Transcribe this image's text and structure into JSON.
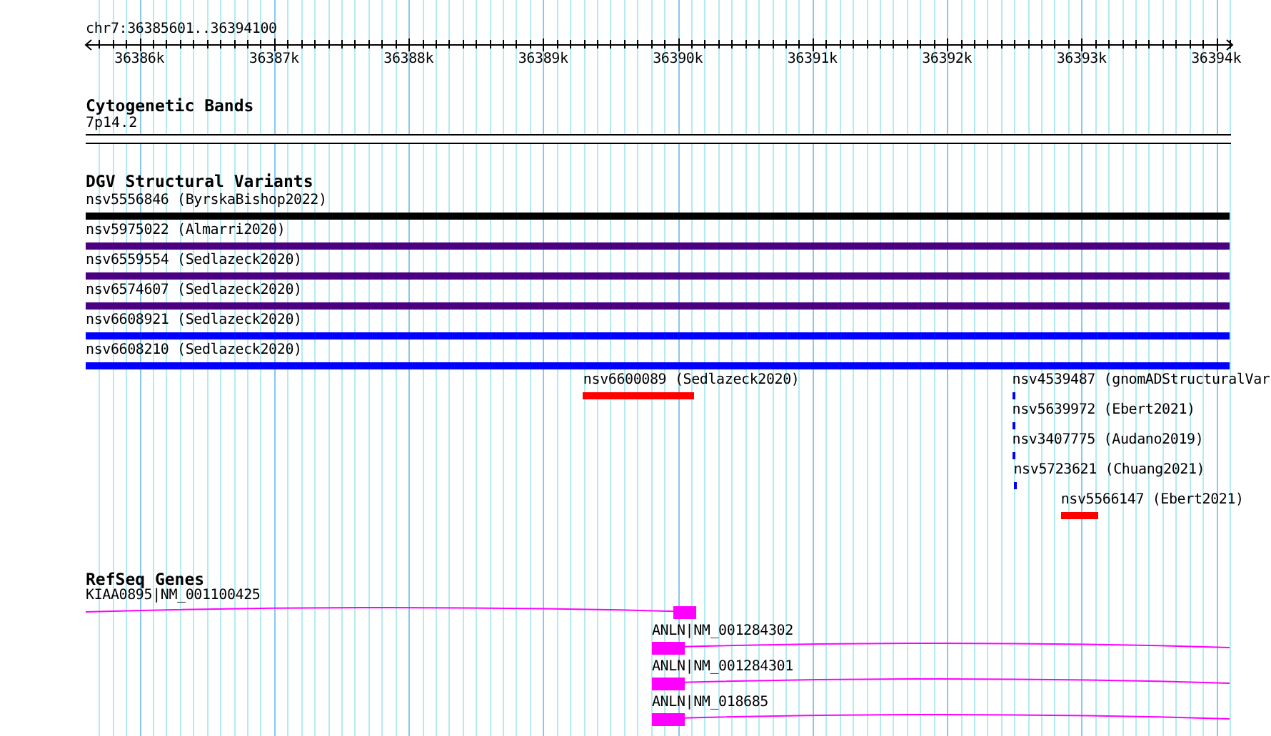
{
  "ruler": {
    "position": "chr7:36385601..36394100",
    "ticks": [
      "36386k",
      "36387k",
      "36388k",
      "36389k",
      "36390k",
      "36391k",
      "36392k",
      "36393k",
      "36394k"
    ]
  },
  "cytoband_track": {
    "title": "Cytogenetic Bands",
    "band": {
      "label": "7p14.2"
    }
  },
  "dgv_track": {
    "title": "DGV Structural Variants",
    "rows": [
      [
        {
          "label": "nsv5556846 (ByrskaBishop2022)",
          "color": "#000000"
        }
      ],
      [
        {
          "label": "nsv5975022 (Almarri2020)",
          "color": "#4b0082"
        }
      ],
      [
        {
          "label": "nsv6559554 (Sedlazeck2020)",
          "color": "#4b0082"
        }
      ],
      [
        {
          "label": "nsv6574607 (Sedlazeck2020)",
          "color": "#4b0082"
        }
      ],
      [
        {
          "label": "nsv6608921 (Sedlazeck2020)",
          "color": "#0000ff"
        }
      ],
      [
        {
          "label": "nsv6608210 (Sedlazeck2020)",
          "color": "#0000ff"
        }
      ],
      [
        {
          "label": "nsv6600089 (Sedlazeck2020)",
          "color": "#ff0000"
        },
        {
          "label": "nsv4539487 (gnomADStructuralVar",
          "color": "#0000ff"
        }
      ],
      [
        {
          "label": "nsv5639972 (Ebert2021)",
          "color": "#0000ff"
        }
      ],
      [
        {
          "label": "nsv3407775 (Audano2019)",
          "color": "#0000ff"
        }
      ],
      [
        {
          "label": "nsv5723621 (Chuang2021)",
          "color": "#0000ff"
        }
      ],
      [
        {
          "label": "nsv5566147 (Ebert2021)",
          "color": "#ff0000"
        }
      ]
    ]
  },
  "refseq_track": {
    "title": "RefSeq Genes",
    "genes": [
      {
        "label": "KIAA0895|NM_001100425"
      },
      {
        "label": "ANLN|NM_001284302"
      },
      {
        "label": "ANLN|NM_001284301"
      },
      {
        "label": "ANLN|NM_018685"
      }
    ]
  }
}
